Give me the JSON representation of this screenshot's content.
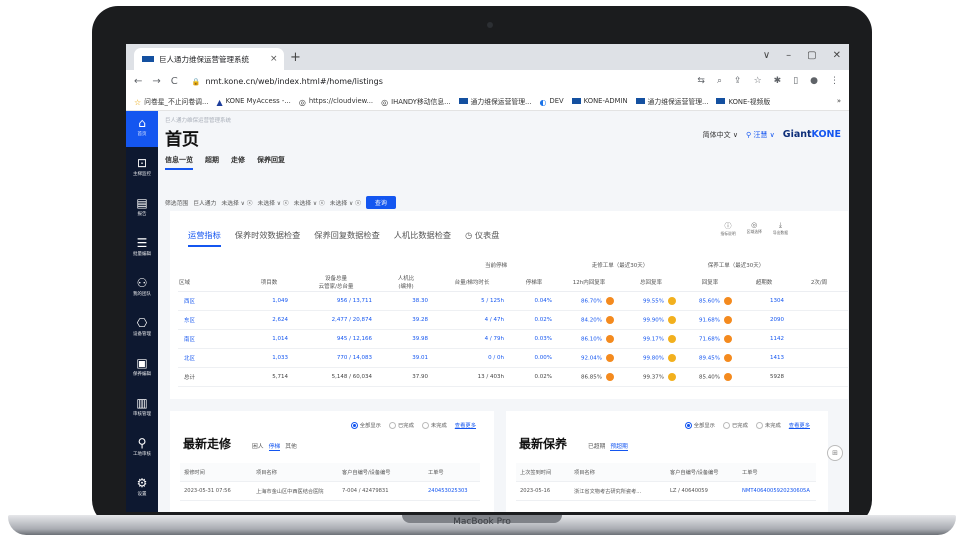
{
  "browser": {
    "tab_title": "巨人通力维保运营管理系统",
    "tab_close": "×",
    "new_tab": "+",
    "window_controls": [
      "∨",
      "–",
      "▢",
      "✕"
    ],
    "nav_buttons": [
      "←",
      "→",
      "C"
    ],
    "url": "nmt.kone.cn/web/index.html#/home/listings",
    "bookmarks": [
      "问卷星_不止问卷调...",
      "KONE MyAccess -...",
      "https://cloudview...",
      "IHANDY移动信息...",
      "通力维保运营管理...",
      "DEV",
      "KONE-ADMIN",
      "通力维保运营管理...",
      "KONE-视频版"
    ]
  },
  "sidebar": {
    "items": [
      {
        "label": "首页",
        "icon": "home-icon",
        "glyph": "⌂"
      },
      {
        "label": "主梯监控",
        "icon": "monitor-icon",
        "glyph": "⊡"
      },
      {
        "label": "报告",
        "icon": "report-icon",
        "glyph": "▤"
      },
      {
        "label": "批量编辑",
        "icon": "batch-edit-icon",
        "glyph": "☰"
      },
      {
        "label": "我的团队",
        "icon": "team-icon",
        "glyph": "⚇"
      },
      {
        "label": "设备管理",
        "icon": "device-icon",
        "glyph": "⎔"
      },
      {
        "label": "保养编辑",
        "icon": "maintenance-icon",
        "glyph": "▣"
      },
      {
        "label": "审核管理",
        "icon": "audit-icon",
        "glyph": "▥"
      },
      {
        "label": "工地审核",
        "icon": "site-audit-icon",
        "glyph": "⚲"
      },
      {
        "label": "设置",
        "icon": "settings-icon",
        "glyph": "⚙"
      }
    ]
  },
  "header": {
    "breadcrumb": "巨人通力维保运营管理系统",
    "title": "首页",
    "language": "简体中文 ∨",
    "user": "汪慧 ∨",
    "brand": "Giant",
    "brand_bold": "KONE"
  },
  "subtabs": [
    "信息一览",
    "超期",
    "走修",
    "保养回复"
  ],
  "filter": {
    "label": "筛选范围",
    "company": "巨人通力",
    "selects": [
      "未选择 ∨ ⓧ",
      "未选择 ∨ ⓧ",
      "未选择 ∨ ⓧ",
      "未选择 ∨ ⓧ"
    ],
    "query_button": "查询"
  },
  "kpi_card": {
    "tabs": [
      "运营指标",
      "保养时效数据检查",
      "保养回复数据检查",
      "人机比数据检查",
      "◷ 仪表盘"
    ],
    "tools": [
      {
        "glyph": "ⓘ",
        "label": "指标说明"
      },
      {
        "glyph": "◎",
        "label": "区域选择"
      },
      {
        "glyph": "⤓",
        "label": "导出数据"
      }
    ],
    "group_headers": {
      "stopped": "当前停梯",
      "repair": "走修工单（最近30天）",
      "maint": "保养工单（最近30天）"
    },
    "columns": [
      "区域",
      "项目数",
      "设备总量\n云管家/总台量",
      "人机比\n(编排)",
      "台量/梯均时长",
      "停梯率",
      "12h内回复率",
      "总回复率",
      "回复率",
      "超期数",
      "2次/周"
    ],
    "rows": [
      {
        "region": "西区",
        "projects": "1,049",
        "devices": "956 / 13,711",
        "ratio": "38.30",
        "stopped": "5 / 125h",
        "stop_rate": "0.04%",
        "r12h": "86.70%",
        "total": "99.55%",
        "m_rate": "85.60%",
        "overdue": "1304"
      },
      {
        "region": "东区",
        "projects": "2,624",
        "devices": "2,477 / 20,874",
        "ratio": "39.28",
        "stopped": "4 / 47h",
        "stop_rate": "0.02%",
        "r12h": "84.20%",
        "total": "99.90%",
        "m_rate": "91.68%",
        "overdue": "2090"
      },
      {
        "region": "南区",
        "projects": "1,014",
        "devices": "945 / 12,166",
        "ratio": "39.98",
        "stopped": "4 / 79h",
        "stop_rate": "0.03%",
        "r12h": "86.10%",
        "total": "99.17%",
        "m_rate": "71.68%",
        "overdue": "1142"
      },
      {
        "region": "北区",
        "projects": "1,033",
        "devices": "770 / 14,083",
        "ratio": "39.01",
        "stopped": "0 / 0h",
        "stop_rate": "0.00%",
        "r12h": "92.04%",
        "total": "99.80%",
        "m_rate": "89.45%",
        "overdue": "1413"
      },
      {
        "region": "总计",
        "projects": "5,714",
        "devices": "5,148 / 60,034",
        "ratio": "37.90",
        "stopped": "13 / 403h",
        "stop_rate": "0.02%",
        "r12h": "86.85%",
        "total": "99.37%",
        "m_rate": "85.40%",
        "overdue": "5928"
      }
    ]
  },
  "repair_card": {
    "title": "最新走修",
    "filters": [
      "困人",
      "停梯",
      "其他"
    ],
    "options": [
      "全部显示",
      "已完成",
      "未完成"
    ],
    "more": "查看更多",
    "columns": [
      "报修时间",
      "项目名称",
      "客户自编号/设备编号",
      "工单号"
    ],
    "rows": [
      {
        "time": "2023-05-31 07:56",
        "project": "上海市金山区中西医结合医院",
        "device": "7-004 / 42479831",
        "order": "240453025303"
      }
    ]
  },
  "maint_card": {
    "title": "最新保养",
    "filters": [
      "已超期",
      "预超期"
    ],
    "options": [
      "全部显示",
      "已完成",
      "未完成"
    ],
    "more": "查看更多",
    "columns": [
      "上次签到时间",
      "项目名称",
      "客户自编号/设备编号",
      "工单号"
    ],
    "rows": [
      {
        "time": "2023-05-16",
        "project": "浙江省文物考古研究所瓷考...",
        "device": "LZ / 40640059",
        "order": "NMT4064005920230605A"
      }
    ]
  },
  "laptop_label": "MacBook Pro",
  "colors": {
    "primary": "#1456f0",
    "sidebar": "#0d1830",
    "warn": "#f48a1e"
  }
}
